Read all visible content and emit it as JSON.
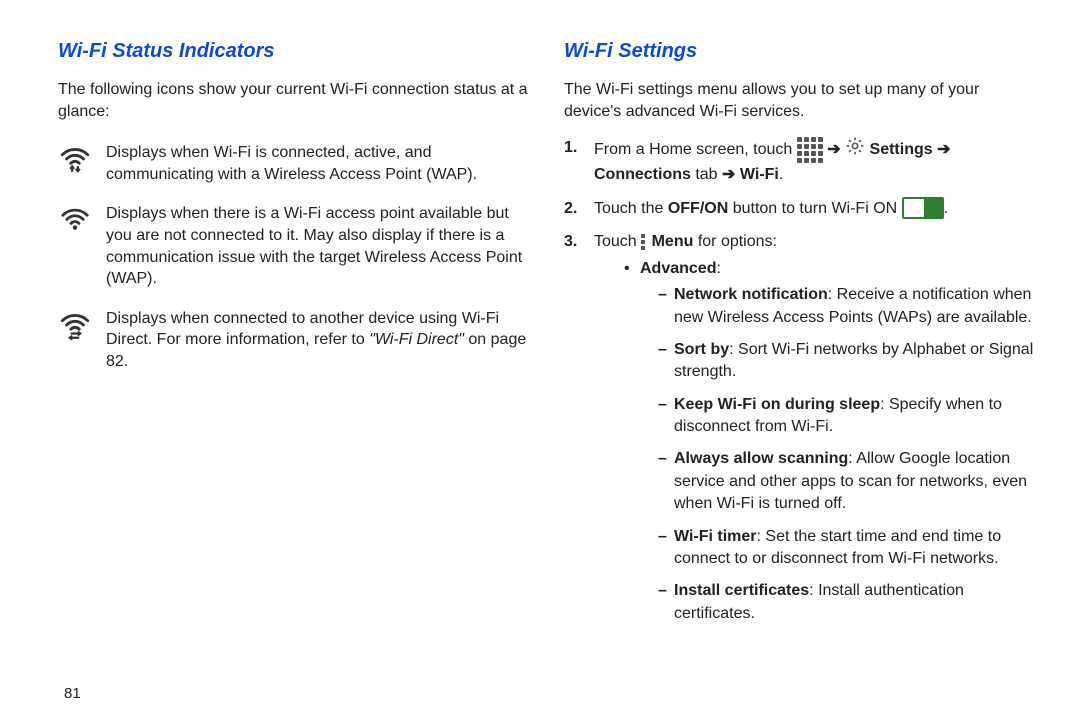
{
  "pageNumber": "81",
  "left": {
    "heading": "Wi-Fi Status Indicators",
    "intro": "The following icons show your current Wi-Fi connection status at a glance:",
    "items": [
      {
        "iconName": "wifi-connected-icon",
        "desc": "Displays when Wi-Fi is connected, active, and communicating with a Wireless Access Point (WAP)."
      },
      {
        "iconName": "wifi-available-icon",
        "desc": "Displays when there is a Wi-Fi access point available but you are not connected to it. May also display if there is a communication issue with the target Wireless Access Point (WAP)."
      },
      {
        "iconName": "wifi-direct-icon",
        "descPrefix": "Displays when connected to another device using Wi-Fi Direct. For more information, refer to ",
        "refTitle": "\"Wi-Fi Direct\"",
        "refSuffix": " on page 82."
      }
    ]
  },
  "right": {
    "heading": "Wi-Fi Settings",
    "intro": "The Wi-Fi settings menu allows you to set up many of your device's advanced Wi-Fi services.",
    "step1": {
      "prefix": "From a Home screen, touch ",
      "arrow": " ➔ ",
      "settings": "Settings",
      "arrow2": " ➔ ",
      "connTab": "Connections",
      "tabWord": " tab ",
      "arrow3": "➔ ",
      "wifi": "Wi-Fi",
      "period": "."
    },
    "step2": {
      "t1": "Touch the ",
      "offon": "OFF/ON",
      "t2": " button to turn Wi-Fi ON ",
      "period": "."
    },
    "step3": {
      "t1": "Touch ",
      "menuWord": "Menu",
      "t2": " for options:",
      "advanced": "Advanced",
      "colon": ":",
      "opts": [
        {
          "title": "Network notification",
          "desc": ": Receive a notification when new Wireless Access Points (WAPs) are available."
        },
        {
          "title": "Sort by",
          "desc": ": Sort Wi-Fi networks by Alphabet or Signal strength."
        },
        {
          "title": "Keep Wi-Fi on during sleep",
          "desc": ": Specify when to disconnect from Wi-Fi."
        },
        {
          "title": "Always allow scanning",
          "desc": ": Allow Google location service and other apps to scan for networks, even when Wi-Fi is turned off."
        },
        {
          "title": "Wi-Fi timer",
          "desc": ": Set the start time and end time to connect to or disconnect from Wi-Fi networks."
        },
        {
          "title": "Install certificates",
          "desc": ": Install authentication certificates."
        }
      ]
    }
  }
}
